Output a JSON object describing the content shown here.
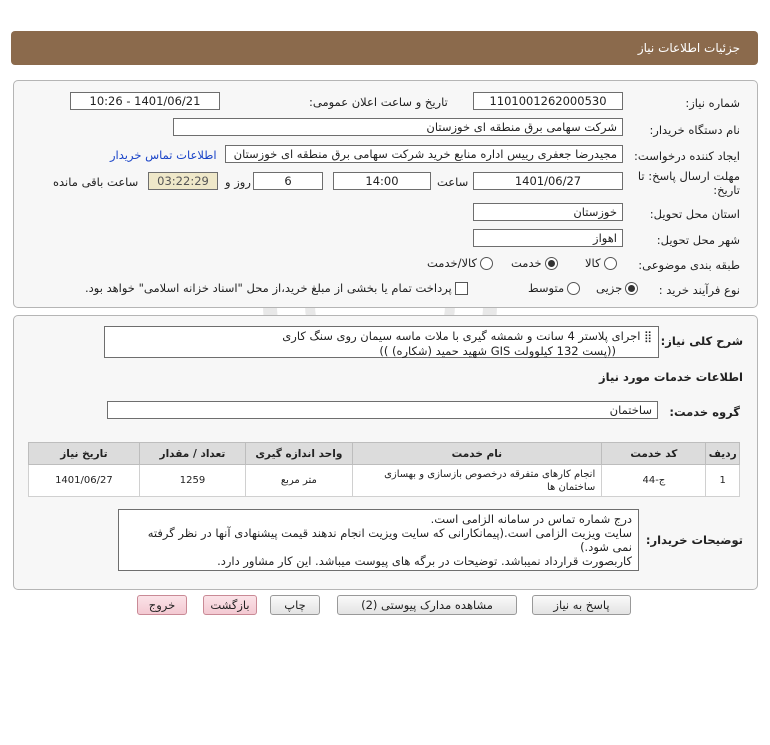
{
  "header": {
    "title": "جزئیات اطلاعات نیاز"
  },
  "info": {
    "need_number_label": "شماره نیاز:",
    "need_number": "1101001262000530",
    "announce_label": "تاریخ و ساعت اعلان عمومی:",
    "announce_value": "1401/06/21 - 10:26",
    "buyer_org_label": "نام دستگاه خریدار:",
    "buyer_org": "شرکت سهامی برق منطقه ای خوزستان",
    "creator_label": "ایجاد کننده درخواست:",
    "creator": "مجیدرضا جعفری رییس اداره منابع خرید شرکت سهامی برق منطقه ای خوزستان",
    "contact_link": "اطلاعات تماس خریدار",
    "deadline_label_1": "مهلت ارسال پاسخ: تا",
    "deadline_label_2": "تاریخ:",
    "deadline_date": "1401/06/27",
    "time_label": "ساعت",
    "deadline_time": "14:00",
    "days_value": "6",
    "days_label": "روز و",
    "remaining_time": "03:22:29",
    "remaining_label": "ساعت باقی مانده",
    "province_label": "استان محل تحویل:",
    "province": "خوزستان",
    "city_label": "شهر محل تحویل:",
    "city": "اهواز",
    "category_label": "طبقه بندی موضوعی:",
    "category_options": [
      "کالا",
      "خدمت",
      "کالا/خدمت"
    ],
    "category_selected": "خدمت",
    "process_label": "نوع فرآیند خرید :",
    "process_options": [
      "جزیی",
      "متوسط"
    ],
    "process_selected": "جزیی",
    "payment_note": "پرداخت تمام یا بخشی از مبلغ خرید،از محل \"اسناد خزانه اسلامی\" خواهد بود."
  },
  "need": {
    "summary_label": "شرح کلی نیاز:",
    "summary_line1": "اجرای پلاستر 4 سانت و شمشه گیری با ملات ماسه سیمان روی سنگ کاری",
    "summary_line2": "((پست 132 کیلوولت GIS  شهید حمید (شکاره)     ))",
    "services_title": "اطلاعات خدمات مورد نیاز",
    "service_group_label": "گروه خدمت:",
    "service_group": "ساختمان",
    "table": {
      "headers": [
        "ردیف",
        "کد خدمت",
        "نام خدمت",
        "واحد اندازه گیری",
        "تعداد / مقدار",
        "تاریخ نیاز"
      ],
      "rows": [
        [
          "1",
          "ج-44",
          "انجام کارهای متفرقه درخصوص بازسازی و بهسازی ساختمان ها",
          "متر مربع",
          "1259",
          "1401/06/27"
        ]
      ]
    },
    "buyer_notes_label": "توضیحات خریدار:",
    "buyer_notes_line1": "درج شماره تماس در سامانه الزامی است.",
    "buyer_notes_line2": "سایت ویزیت الزامی است.(پیمانکارانی که سایت ویزیت انجام ندهند قیمت پیشنهادی آنها در نظر گرفته نمی شود.)",
    "buyer_notes_line3": "کاربصورت قرارداد نمیباشد. توضیحات در برگه های پیوست میباشد. این کار مشاور دارد."
  },
  "buttons": {
    "reply": "پاسخ به نیاز",
    "attachments": "مشاهده مدارک پیوستی (2)",
    "print": "چاپ",
    "back": "بازگشت",
    "exit": "خروج"
  },
  "colors": {
    "header_bg": "#8b6a4c",
    "link": "#1a44c8",
    "timer_bg": "#efe8c9"
  }
}
